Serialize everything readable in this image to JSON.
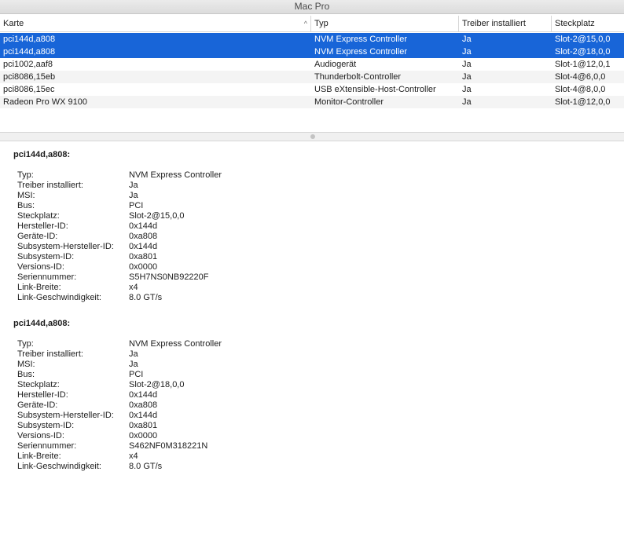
{
  "window": {
    "title": "Mac Pro"
  },
  "table": {
    "columns": [
      "Karte",
      "Typ",
      "Treiber installiert",
      "Steckplatz"
    ],
    "sort_indicator": "^",
    "rows": [
      {
        "karte": "pci144d,a808",
        "typ": "NVM Express Controller",
        "treiber": "Ja",
        "steckplatz": "Slot-2@15,0,0",
        "selected": true
      },
      {
        "karte": "pci144d,a808",
        "typ": "NVM Express Controller",
        "treiber": "Ja",
        "steckplatz": "Slot-2@18,0,0",
        "selected": true
      },
      {
        "karte": "pci1002,aaf8",
        "typ": "Audiogerät",
        "treiber": "Ja",
        "steckplatz": "Slot-1@12,0,1",
        "selected": false
      },
      {
        "karte": "pci8086,15eb",
        "typ": "Thunderbolt-Controller",
        "treiber": "Ja",
        "steckplatz": "Slot-4@6,0,0",
        "selected": false
      },
      {
        "karte": "pci8086,15ec",
        "typ": "USB eXtensible-Host-Controller",
        "treiber": "Ja",
        "steckplatz": "Slot-4@8,0,0",
        "selected": false
      },
      {
        "karte": "Radeon Pro WX 9100",
        "typ": "Monitor-Controller",
        "treiber": "Ja",
        "steckplatz": "Slot-1@12,0,0",
        "selected": false
      }
    ]
  },
  "details": [
    {
      "title": "pci144d,a808:",
      "properties": [
        {
          "key": "Typ:",
          "value": "NVM Express Controller"
        },
        {
          "key": "Treiber installiert:",
          "value": "Ja"
        },
        {
          "key": "MSI:",
          "value": "Ja"
        },
        {
          "key": "Bus:",
          "value": "PCI"
        },
        {
          "key": "Steckplatz:",
          "value": "Slot-2@15,0,0"
        },
        {
          "key": "Hersteller-ID:",
          "value": "0x144d"
        },
        {
          "key": "Geräte-ID:",
          "value": "0xa808"
        },
        {
          "key": "Subsystem-Hersteller-ID:",
          "value": "0x144d"
        },
        {
          "key": "Subsystem-ID:",
          "value": "0xa801"
        },
        {
          "key": "Versions-ID:",
          "value": "0x0000"
        },
        {
          "key": "Seriennummer:",
          "value": "S5H7NS0NB92220F"
        },
        {
          "key": "Link-Breite:",
          "value": "x4"
        },
        {
          "key": "Link-Geschwindigkeit:",
          "value": "8.0 GT/s"
        }
      ]
    },
    {
      "title": "pci144d,a808:",
      "properties": [
        {
          "key": "Typ:",
          "value": "NVM Express Controller"
        },
        {
          "key": "Treiber installiert:",
          "value": "Ja"
        },
        {
          "key": "MSI:",
          "value": "Ja"
        },
        {
          "key": "Bus:",
          "value": "PCI"
        },
        {
          "key": "Steckplatz:",
          "value": "Slot-2@18,0,0"
        },
        {
          "key": "Hersteller-ID:",
          "value": "0x144d"
        },
        {
          "key": "Geräte-ID:",
          "value": "0xa808"
        },
        {
          "key": "Subsystem-Hersteller-ID:",
          "value": "0x144d"
        },
        {
          "key": "Subsystem-ID:",
          "value": "0xa801"
        },
        {
          "key": "Versions-ID:",
          "value": "0x0000"
        },
        {
          "key": "Seriennummer:",
          "value": "S462NF0M318221N"
        },
        {
          "key": "Link-Breite:",
          "value": "x4"
        },
        {
          "key": "Link-Geschwindigkeit:",
          "value": "8.0 GT/s"
        }
      ]
    }
  ],
  "colors": {
    "selection": "#1865d8",
    "alt_row": "#f4f4f4"
  }
}
